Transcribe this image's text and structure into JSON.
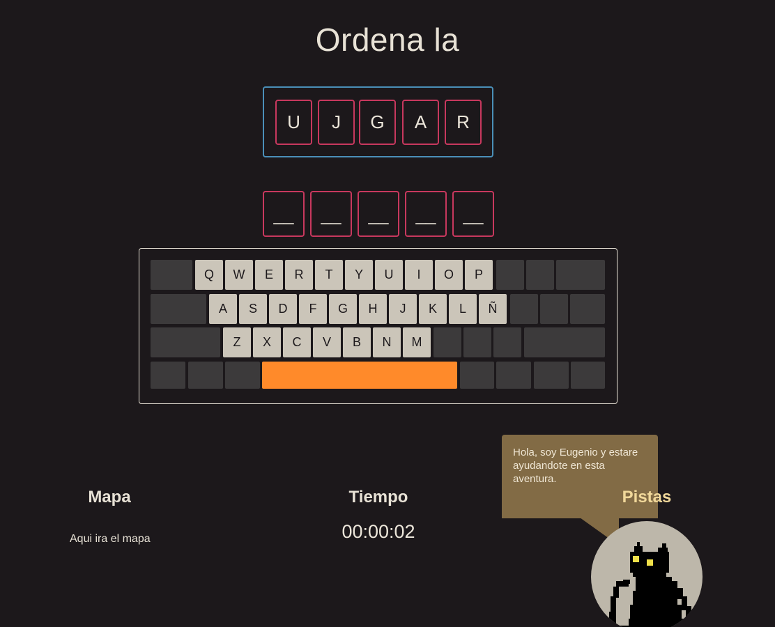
{
  "title": "Ordena la",
  "scrambled_letters": [
    "U",
    "J",
    "G",
    "A",
    "R"
  ],
  "answer_slots": [
    "__",
    "__",
    "__",
    "__",
    "__"
  ],
  "keyboard": {
    "row1": [
      "Q",
      "W",
      "E",
      "R",
      "T",
      "Y",
      "U",
      "I",
      "O",
      "P"
    ],
    "row2": [
      "A",
      "S",
      "D",
      "F",
      "G",
      "H",
      "J",
      "K",
      "L",
      "Ñ"
    ],
    "row3": [
      "Z",
      "X",
      "C",
      "V",
      "B",
      "N",
      "M"
    ],
    "space_color": "#ff8a2a"
  },
  "map": {
    "heading": "Mapa",
    "text": "Aqui ira el mapa"
  },
  "time": {
    "heading": "Tiempo",
    "value": "00:00:02"
  },
  "hints": {
    "heading": "Pistas",
    "bubble_text": "Hola, soy Eugenio y estare ayudandote en esta aventura.",
    "avatar_icon": "pixel-black-cat-icon"
  },
  "colors": {
    "background": "#1c181b",
    "tile_border": "#c8385e",
    "scramble_border": "#4a8fb8",
    "bubble": "#826b45"
  }
}
